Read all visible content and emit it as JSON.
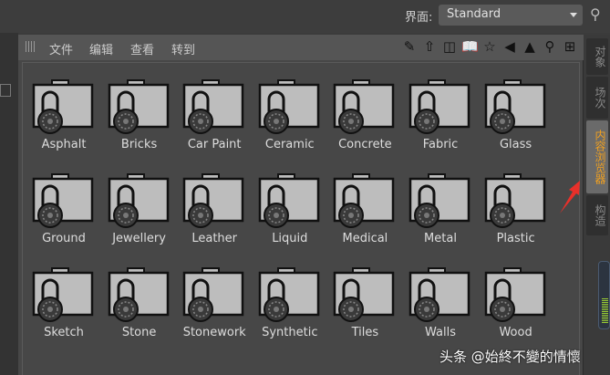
{
  "topbar": {
    "label": "界面:",
    "layout_value": "Standard"
  },
  "menu": [
    "文件",
    "编辑",
    "查看",
    "转到"
  ],
  "toolbar_icons": [
    "edit-icon",
    "home-icon",
    "jar-icon",
    "book-icon",
    "star-icon",
    "back-arrow-icon",
    "forward-arrow-icon",
    "search-icon",
    "new-window-icon"
  ],
  "materials": [
    "Asphalt",
    "Bricks",
    "Car Paint",
    "Ceramic",
    "Concrete",
    "Fabric",
    "Glass",
    "Ground",
    "Jewellery",
    "Leather",
    "Liquid",
    "Medical",
    "Metal",
    "Plastic",
    "Sketch",
    "Stone",
    "Stonework",
    "Synthetic",
    "Tiles",
    "Walls",
    "Wood"
  ],
  "side_tabs": [
    {
      "label": "对象",
      "active": false
    },
    {
      "label": "场次",
      "active": false
    },
    {
      "label": "内容浏览器",
      "active": true
    },
    {
      "label": "构造",
      "active": false
    }
  ],
  "watermark": "头条 @始終不變的情懷",
  "colors": {
    "active_tab": "#f0a020",
    "annotation_arrow": "#e8302a"
  }
}
